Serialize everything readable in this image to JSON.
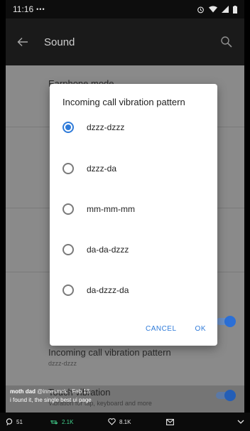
{
  "status_bar": {
    "time": "11:16",
    "dots": "•••"
  },
  "app_bar": {
    "title": "Sound"
  },
  "background": {
    "items": [
      {
        "title": "Earphone mode",
        "subtitle": ""
      },
      {
        "title": "Incoming call vibration pattern",
        "subtitle": "dzzz-dzzz"
      },
      {
        "title": "Touch vibration",
        "subtitle": "Vibration for tap, keyboard and more"
      }
    ]
  },
  "dialog": {
    "title": "Incoming call vibration pattern",
    "options": [
      {
        "label": "dzzz-dzzz",
        "selected": true
      },
      {
        "label": "dzzz-da",
        "selected": false
      },
      {
        "label": "mm-mm-mm",
        "selected": false
      },
      {
        "label": "da-da-dzzz",
        "selected": false
      },
      {
        "label": "da-dzzz-da",
        "selected": false
      }
    ],
    "cancel": "CANCEL",
    "ok": "OK"
  },
  "tweet": {
    "author": "moth dad",
    "meta": "@innesmck · Feb 13",
    "text": "i found it, the single best ui page"
  },
  "action_bar": {
    "replies": "51",
    "retweets": "2.1K",
    "likes": "8.1K"
  },
  "colors": {
    "accent": "#2f7bd9",
    "retweet": "#41d18c"
  }
}
